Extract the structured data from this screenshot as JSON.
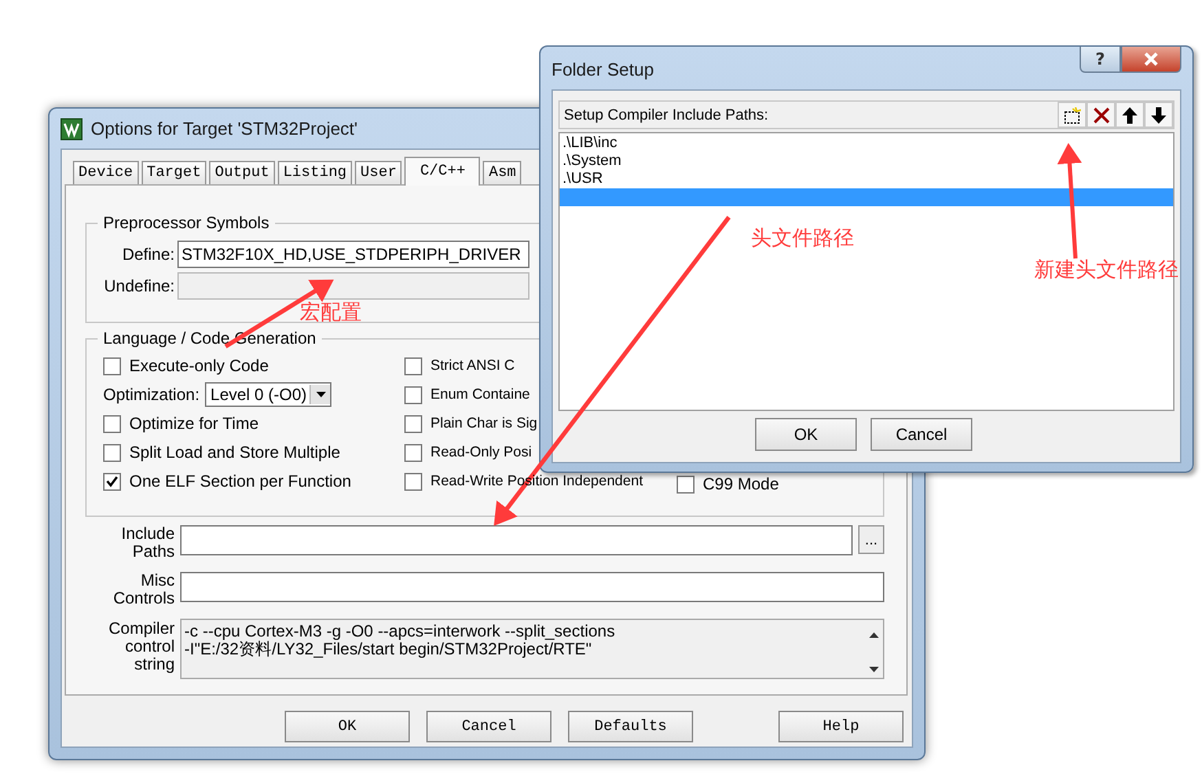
{
  "options_window": {
    "title": "Options for Target 'STM32Project'",
    "tabs": [
      {
        "label": "Device",
        "selected": false
      },
      {
        "label": "Target",
        "selected": false
      },
      {
        "label": "Output",
        "selected": false
      },
      {
        "label": "Listing",
        "selected": false
      },
      {
        "label": "User",
        "selected": false
      },
      {
        "label": "C/C++",
        "selected": true
      },
      {
        "label": "Asm",
        "selected": false
      }
    ],
    "preprocessor": {
      "title": "Preprocessor Symbols",
      "define_label": "Define:",
      "define_value": "STM32F10X_HD,USE_STDPERIPH_DRIVER",
      "undefine_label": "Undefine:"
    },
    "language": {
      "title": "Language / Code Generation",
      "left_options": [
        {
          "kind": "checkbox",
          "label": "Execute-only Code",
          "checked": false
        },
        {
          "kind": "dropdown",
          "label": "Optimization:",
          "value": "Level 0 (-O0)"
        },
        {
          "kind": "checkbox",
          "label": "Optimize for Time",
          "checked": false
        },
        {
          "kind": "checkbox",
          "label": "Split Load and Store Multiple",
          "checked": false
        },
        {
          "kind": "checkbox",
          "label": "One ELF Section per Function",
          "checked": true
        }
      ],
      "right_options": [
        {
          "label": "Strict ANSI C",
          "checked": false
        },
        {
          "label": "Enum Containe",
          "checked": false
        },
        {
          "label": "Plain Char is Sig",
          "checked": false
        },
        {
          "label": "Read-Only Posi",
          "checked": false
        },
        {
          "label": "Read-Write Position Independent",
          "checked": false
        }
      ],
      "third_options": [
        {
          "label": "C99 Mode",
          "checked": false
        }
      ]
    },
    "include_paths": {
      "label": "Include Paths",
      "browse": "..."
    },
    "misc_controls": {
      "label": "Misc Controls"
    },
    "compiler_string": {
      "label": "Compiler control string",
      "lines": [
        "-c --cpu Cortex-M3 -g -O0 --apcs=interwork --split_sections",
        "-I\"E:/32资料/LY32_Files/start begin/STM32Project/RTE\""
      ]
    },
    "buttons": [
      "OK",
      "Cancel",
      "Defaults",
      "Help"
    ]
  },
  "folder_window": {
    "title": "Folder Setup",
    "help_button": "?",
    "header": "Setup Compiler Include Paths:",
    "paths": [
      {
        "text": ".\\LIB\\inc",
        "selected": false
      },
      {
        "text": ".\\System",
        "selected": false
      },
      {
        "text": ".\\USR",
        "selected": false
      },
      {
        "selected": true
      }
    ],
    "buttons": [
      "OK",
      "Cancel"
    ]
  },
  "annotations": [
    "宏配置",
    "头文件路径",
    "新建头文件路径"
  ]
}
